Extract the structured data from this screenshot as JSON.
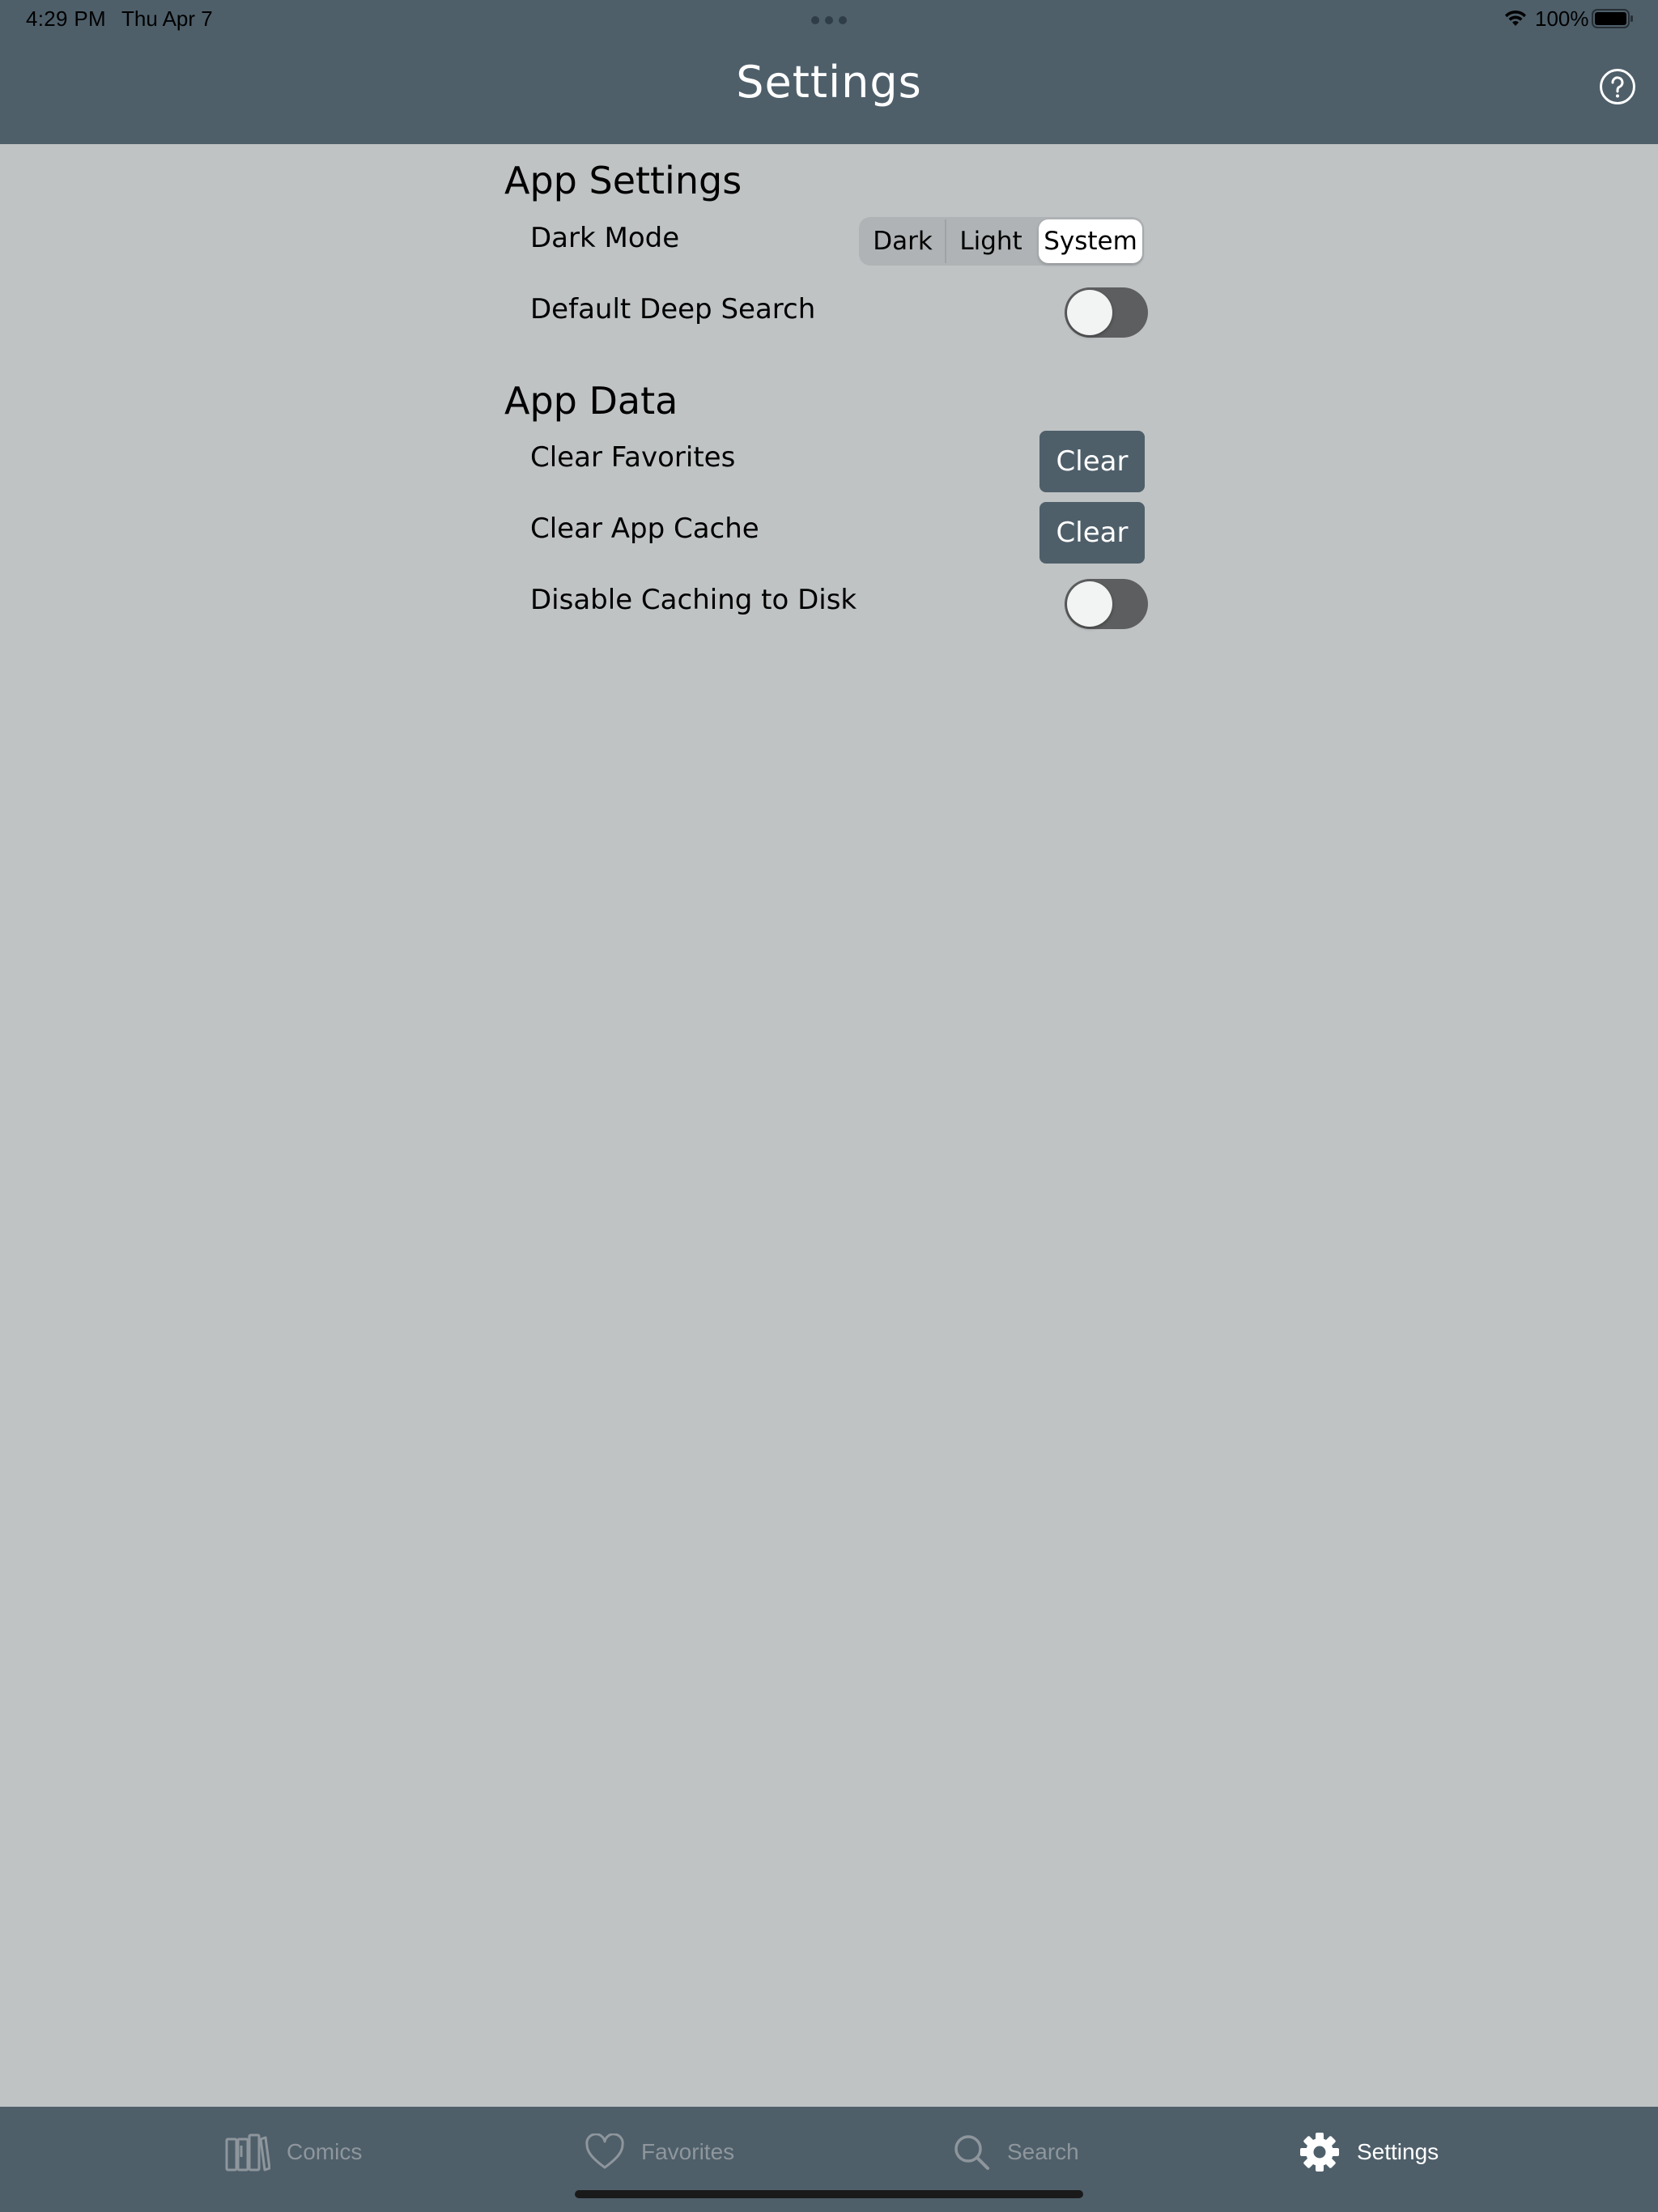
{
  "status_bar": {
    "time": "4:29 PM",
    "date": "Thu Apr 7",
    "battery": "100%"
  },
  "header": {
    "title": "Settings",
    "help_icon": "help-circle-icon"
  },
  "app_settings": {
    "title": "App Settings",
    "dark_mode": {
      "label": "Dark Mode",
      "options": [
        "Dark",
        "Light",
        "System"
      ],
      "selected": "System"
    },
    "default_deep_search": {
      "label": "Default Deep Search",
      "on": false
    }
  },
  "app_data": {
    "title": "App Data",
    "clear_favorites": {
      "label": "Clear Favorites",
      "button": "Clear"
    },
    "clear_app_cache": {
      "label": "Clear App Cache",
      "button": "Clear"
    },
    "disable_caching": {
      "label": "Disable Caching to Disk",
      "on": false
    }
  },
  "tabs": [
    {
      "label": "Comics",
      "icon": "books-icon",
      "active": false
    },
    {
      "label": "Favorites",
      "icon": "heart-icon",
      "active": false
    },
    {
      "label": "Search",
      "icon": "search-icon",
      "active": false
    },
    {
      "label": "Settings",
      "icon": "gear-icon",
      "active": true
    }
  ],
  "colors": {
    "header_bg": "#4e5f6a",
    "page_bg": "#bfc3c4",
    "button_bg": "#4e5f6a",
    "toggle_off": "#5d5e5f"
  }
}
